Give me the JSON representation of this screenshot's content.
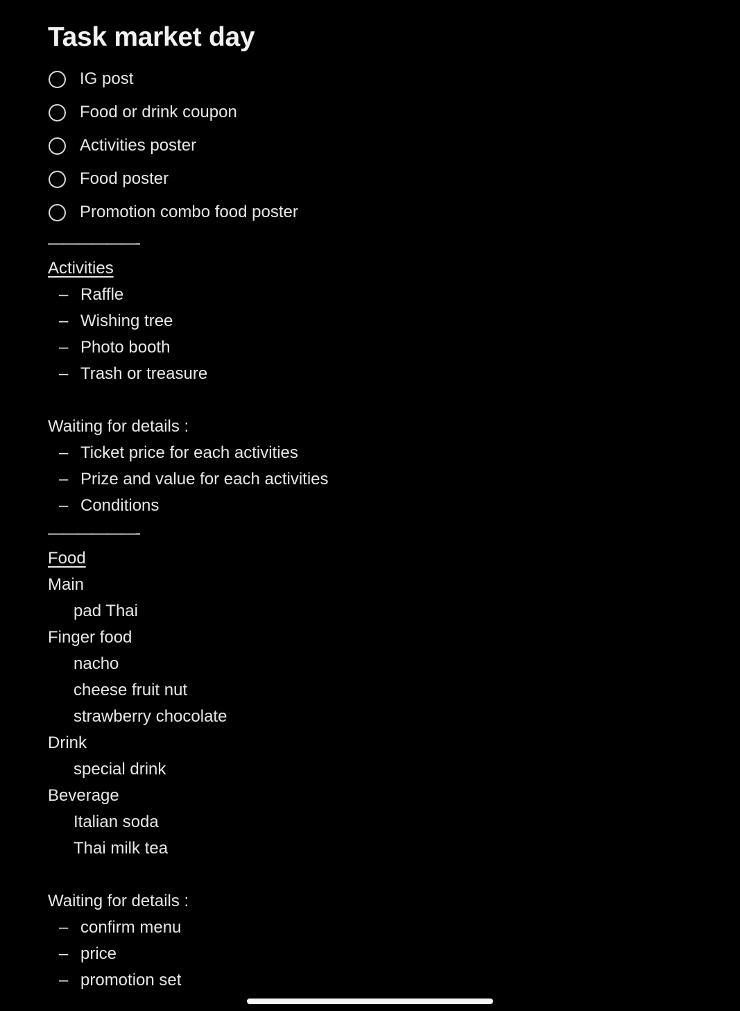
{
  "note": {
    "title": "Task market day",
    "checklist": [
      {
        "label": "IG post",
        "checked": false
      },
      {
        "label": "Food or drink coupon",
        "checked": false
      },
      {
        "label": "Activities poster",
        "checked": false
      },
      {
        "label": "Food poster",
        "checked": false
      },
      {
        "label": "Promotion combo food poster",
        "checked": false
      }
    ],
    "divider_1": "——————-",
    "activities": {
      "heading": "Activities",
      "items": [
        "Raffle",
        "Wishing tree",
        "Photo booth",
        "Trash or treasure"
      ],
      "waiting_label": "Waiting for details :",
      "waiting_items": [
        "Ticket price for each activities",
        "Prize and value for each activities",
        "Conditions"
      ]
    },
    "divider_2": "——————-",
    "food": {
      "heading": "Food",
      "groups": [
        {
          "label": "Main",
          "items": [
            "pad Thai"
          ]
        },
        {
          "label": "Finger food",
          "items": [
            "nacho",
            "cheese fruit nut",
            "strawberry chocolate"
          ]
        },
        {
          "label": "Drink",
          "items": [
            "special drink"
          ]
        },
        {
          "label": "Beverage",
          "items": [
            "Italian soda",
            "Thai milk tea"
          ]
        }
      ],
      "waiting_label": "Waiting for details :",
      "waiting_items": [
        "confirm menu",
        "price",
        "promotion set"
      ]
    },
    "dash_glyph": "–"
  },
  "colors": {
    "background": "#000000",
    "text": "#e8e8e8",
    "home_indicator": "#f5f5f5"
  }
}
